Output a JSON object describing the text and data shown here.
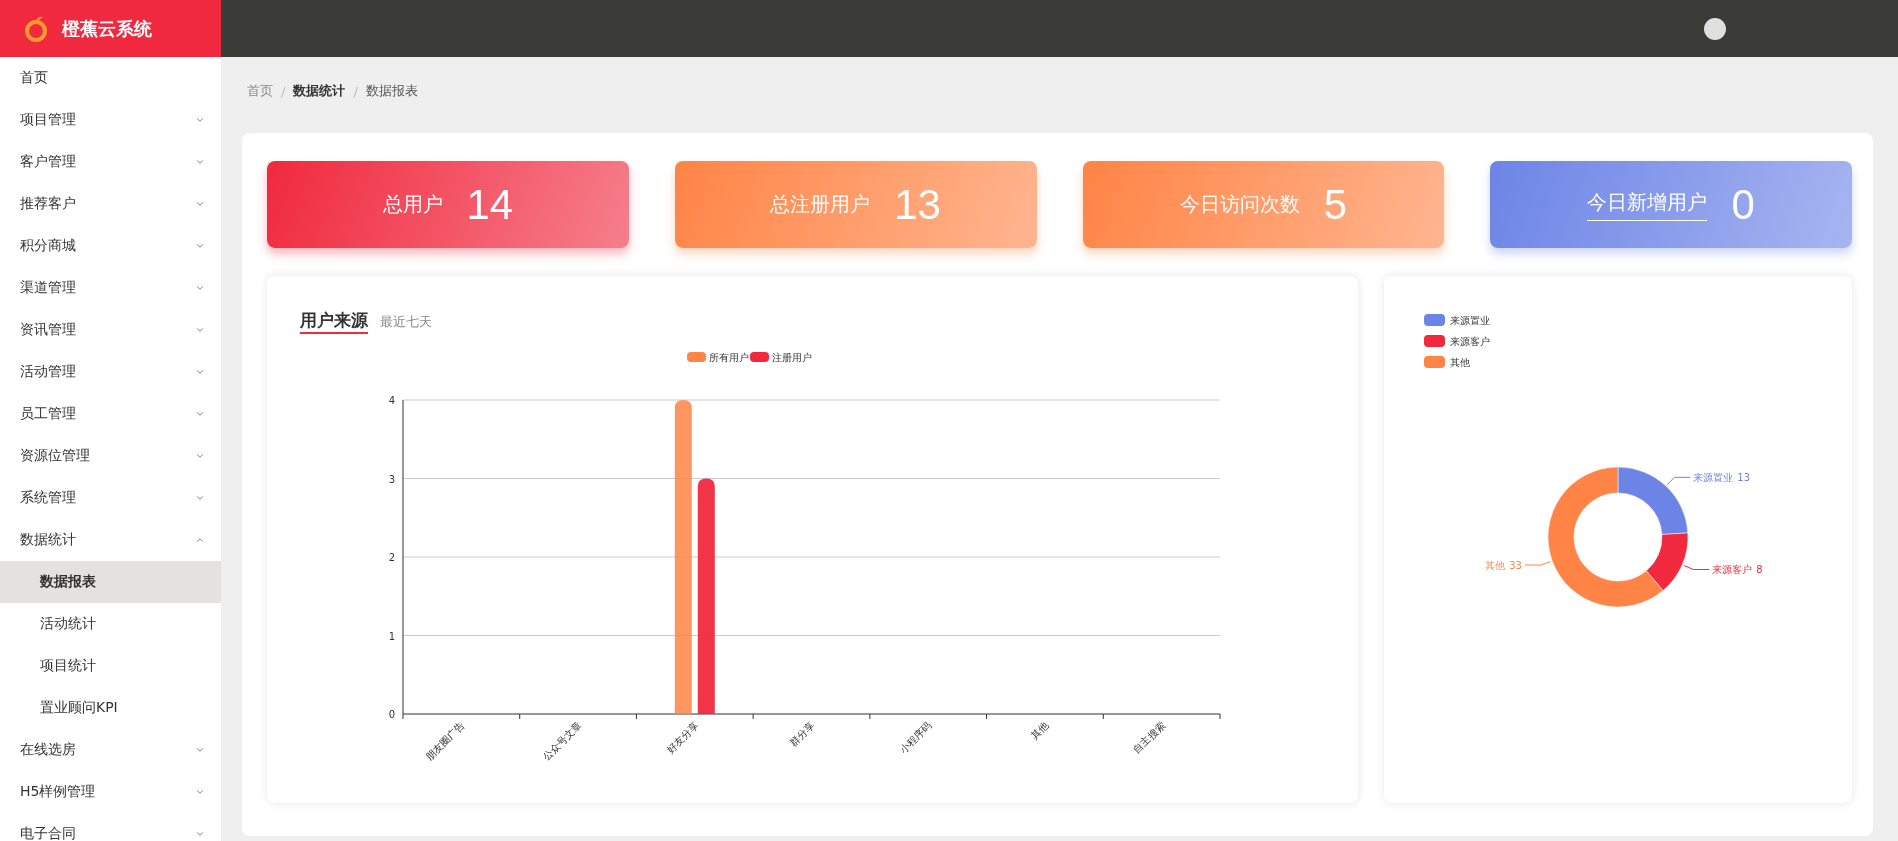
{
  "app": {
    "name": "橙蕉云系统"
  },
  "sidebar": {
    "items": [
      {
        "label": "首页"
      },
      {
        "label": "项目管理",
        "expanded": false
      },
      {
        "label": "客户管理",
        "expanded": false
      },
      {
        "label": "推荐客户",
        "expanded": false
      },
      {
        "label": "积分商城",
        "expanded": false
      },
      {
        "label": "渠道管理",
        "expanded": false
      },
      {
        "label": "资讯管理",
        "expanded": false
      },
      {
        "label": "活动管理",
        "expanded": false
      },
      {
        "label": "员工管理",
        "expanded": false
      },
      {
        "label": "资源位管理",
        "expanded": false
      },
      {
        "label": "系统管理",
        "expanded": false
      },
      {
        "label": "数据统计",
        "expanded": true,
        "children": [
          {
            "label": "数据报表",
            "selected": true
          },
          {
            "label": "活动统计",
            "selected": false
          },
          {
            "label": "项目统计",
            "selected": false
          },
          {
            "label": "置业顾问KPI",
            "selected": false
          }
        ]
      },
      {
        "label": "在线选房",
        "expanded": false
      },
      {
        "label": "H5样例管理",
        "expanded": false
      },
      {
        "label": "电子合同",
        "expanded": false
      }
    ]
  },
  "breadcrumb": {
    "separator": "/",
    "items": [
      "首页",
      "数据统计",
      "数据报表"
    ]
  },
  "stats": [
    {
      "label": "总用户",
      "value": "14",
      "color": "#f0293e",
      "underlined": false
    },
    {
      "label": "总注册用户",
      "value": "13",
      "color": "#ff8446",
      "underlined": false
    },
    {
      "label": "今日访问次数",
      "value": "5",
      "color": "#ff8446",
      "underlined": false
    },
    {
      "label": "今日新增用户",
      "value": "0",
      "color": "#6c84e6",
      "underlined": true
    }
  ],
  "user_source": {
    "title": "用户来源",
    "subtitle": "最近七天",
    "chart_data": {
      "type": "bar",
      "categories": [
        "朋友圈广告",
        "公众号文章",
        "好友分享",
        "群分享",
        "小程序码",
        "其他",
        "自主搜索"
      ],
      "series": [
        {
          "name": "所有用户",
          "color": "#ff8446",
          "values": [
            0,
            0,
            4,
            0,
            0,
            0,
            0
          ]
        },
        {
          "name": "注册用户",
          "color": "#f0293e",
          "values": [
            0,
            0,
            3,
            0,
            0,
            0,
            0
          ]
        }
      ],
      "ylim": [
        0,
        4
      ],
      "yticks": [
        0,
        1,
        2,
        3,
        4
      ],
      "grid": true,
      "legend": true
    }
  },
  "source_share": {
    "chart_data": {
      "type": "donut",
      "categories": [
        "来源置业",
        "来源客户",
        "其他"
      ],
      "values": [
        13,
        8,
        33
      ],
      "colors": [
        "#6c84e6",
        "#f0293e",
        "#ff8446"
      ],
      "data_labels": true,
      "legend": true
    }
  }
}
